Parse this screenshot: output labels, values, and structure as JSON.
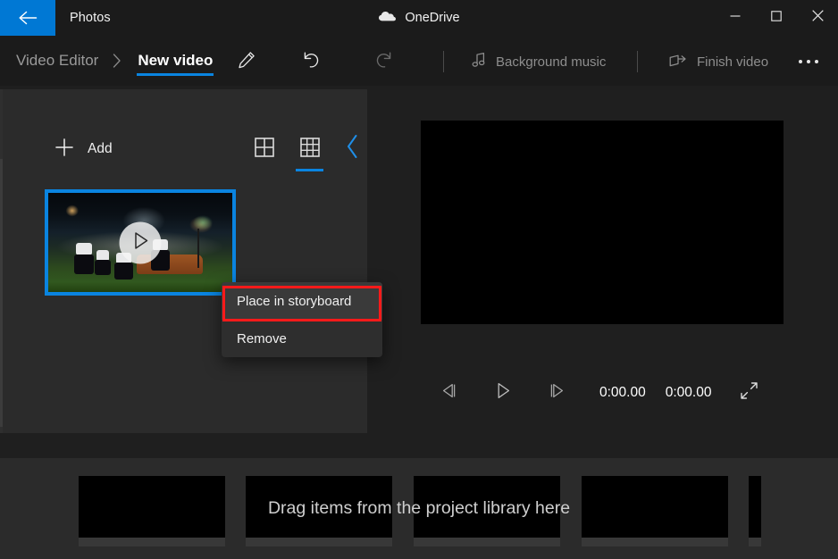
{
  "titlebar": {
    "back_label": "Back",
    "back_icon": "arrow-left-icon",
    "app_title": "Photos",
    "account": {
      "icon": "onedrive-cloud-icon",
      "label": "OneDrive"
    },
    "window_controls": {
      "minimize_icon": "minimize-icon",
      "maximize_icon": "maximize-icon",
      "close_icon": "close-icon"
    }
  },
  "commandbar": {
    "breadcrumb_parent": "Video Editor",
    "breadcrumb_separator_icon": "chevron-right-icon",
    "breadcrumb_current": "New video",
    "rename_icon": "pencil-icon",
    "undo_icon": "undo-icon",
    "redo_icon": "redo-icon",
    "background_music": {
      "icon": "music-note-icon",
      "label": "Background music"
    },
    "finish_video": {
      "icon": "share-export-icon",
      "label": "Finish video"
    },
    "overflow_label": "See more"
  },
  "library": {
    "add": {
      "icon": "plus-icon",
      "label": "Add"
    },
    "view_large_icon": "grid-large-icon",
    "view_small_icon": "grid-small-icon",
    "selected_view": "grid-small-icon",
    "collapse_icon": "chevron-left-icon",
    "items": [
      {
        "name": "video-thumbnail",
        "selected": true,
        "play_icon": "play-icon"
      }
    ]
  },
  "context_menu": {
    "items": [
      {
        "label": "Place in storyboard",
        "highlighted": true
      },
      {
        "label": "Remove",
        "highlighted": false
      }
    ],
    "annotation_color": "#ff1a1a"
  },
  "preview": {
    "stage_color": "#000000",
    "controls": {
      "previous_frame_icon": "previous-frame-icon",
      "play_icon": "play-icon",
      "next_frame_icon": "next-frame-icon",
      "current_time": "0:00.00",
      "total_time": "0:00.00",
      "fullscreen_icon": "fullscreen-icon"
    }
  },
  "storyboard": {
    "hint": "Drag items from the project library here",
    "placeholder_count": 4,
    "partial_placeholder": true
  },
  "colors": {
    "accent": "#0a84e0",
    "back_button_bg": "#0078d4",
    "panel_bg": "#2b2b2b",
    "window_bg": "#1f1f1f",
    "titlebar_bg": "#1b1b1b",
    "annotation": "#ff1a1a"
  }
}
